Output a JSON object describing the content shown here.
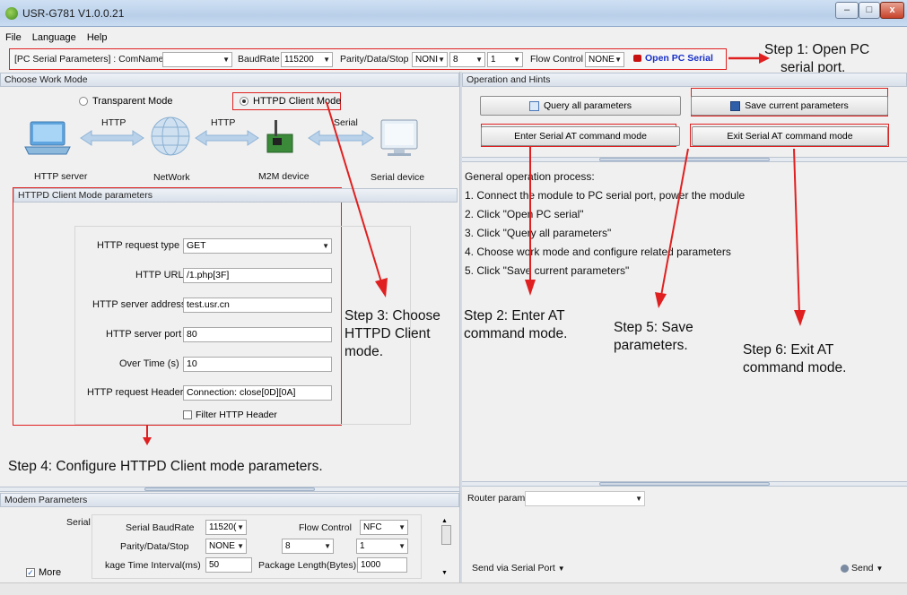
{
  "app": {
    "title": "USR-G781 V1.0.0.21",
    "window_buttons": [
      "–",
      "□",
      "x"
    ]
  },
  "menu": [
    "File",
    "Language",
    "Help"
  ],
  "serial": {
    "section_label": "[PC Serial Parameters] : ComName",
    "comname_value": "",
    "baud_label": "BaudRate",
    "baud_value": "115200",
    "parity_label": "Parity/Data/Stop",
    "parity_value": "NONI",
    "data_value": "8",
    "stop_value": "1",
    "flow_label": "Flow Control",
    "flow_value": "NONE",
    "open_button": "Open PC Serial"
  },
  "work_mode": {
    "header": "Choose Work Mode",
    "transparent": "Transparent Mode",
    "httpd": "HTTPD Client Mode",
    "diagram": {
      "http1": "HTTP",
      "http2": "HTTP",
      "serial": "Serial",
      "http_server": "HTTP server",
      "network": "NetWork",
      "m2m": "M2M device",
      "serial_device": "Serial device"
    }
  },
  "httpd_params": {
    "header": "HTTPD Client Mode parameters",
    "request_type_label": "HTTP request type",
    "request_type_value": "GET",
    "url_label": "HTTP URL",
    "url_value": "/1.php[3F]",
    "server_address_label": "HTTP server address",
    "server_address_value": "test.usr.cn",
    "server_port_label": "HTTP server port",
    "server_port_value": "80",
    "overtime_label": "Over Time (s)",
    "overtime_value": "10",
    "req_header_label": "HTTP request Header",
    "req_header_value": "Connection: close[0D][0A]",
    "filter_label": "Filter HTTP Header"
  },
  "operation": {
    "header": "Operation and Hints",
    "query_button": "Query all parameters",
    "save_button": "Save current parameters",
    "enter_at_button": "Enter Serial AT command mode",
    "exit_at_button": "Exit Serial AT command mode",
    "process_title": "General operation process:",
    "steps": [
      "1. Connect the module to PC serial port, power the module",
      "2. Click \"Open PC serial\"",
      "3. Click \"Query all parameters\"",
      "4. Choose work mode and configure related parameters",
      "5. Click \"Save current parameters\""
    ]
  },
  "annotations": {
    "step1": [
      "Step 1: Open PC",
      "serial port."
    ],
    "step2": [
      "Step 2: Enter AT",
      "command mode."
    ],
    "step3": [
      "Step 3: Choose",
      "HTTPD Client",
      "mode."
    ],
    "step4": "Step 4: Configure HTTPD Client mode parameters.",
    "step5": [
      "Step 5: Save",
      "parameters."
    ],
    "step6": [
      "Step 6: Exit AT",
      "command mode."
    ]
  },
  "modem": {
    "header": "Modem Parameters",
    "serial_label": "Serial",
    "baud_label": "Serial BaudRate",
    "baud_value": "11520(",
    "flow_label": "Flow Control",
    "flow_value": "NFC",
    "parity_label": "Parity/Data/Stop",
    "parity_value": "NONE",
    "data_value": "8",
    "stop_value": "1",
    "pkt_interval_label": "kage Time Interval(ms)",
    "pkt_interval_value": "50",
    "pkt_len_label": "Package Length(Bytes)",
    "pkt_len_value": "1000",
    "more_label": "More"
  },
  "router": {
    "label": "Router params",
    "value": ""
  },
  "send": {
    "via_label": "Send via Serial Port",
    "send_button": "Send"
  },
  "colors": {
    "annotation_red": "#e02020",
    "open_serial_blue": "#1830c8"
  }
}
